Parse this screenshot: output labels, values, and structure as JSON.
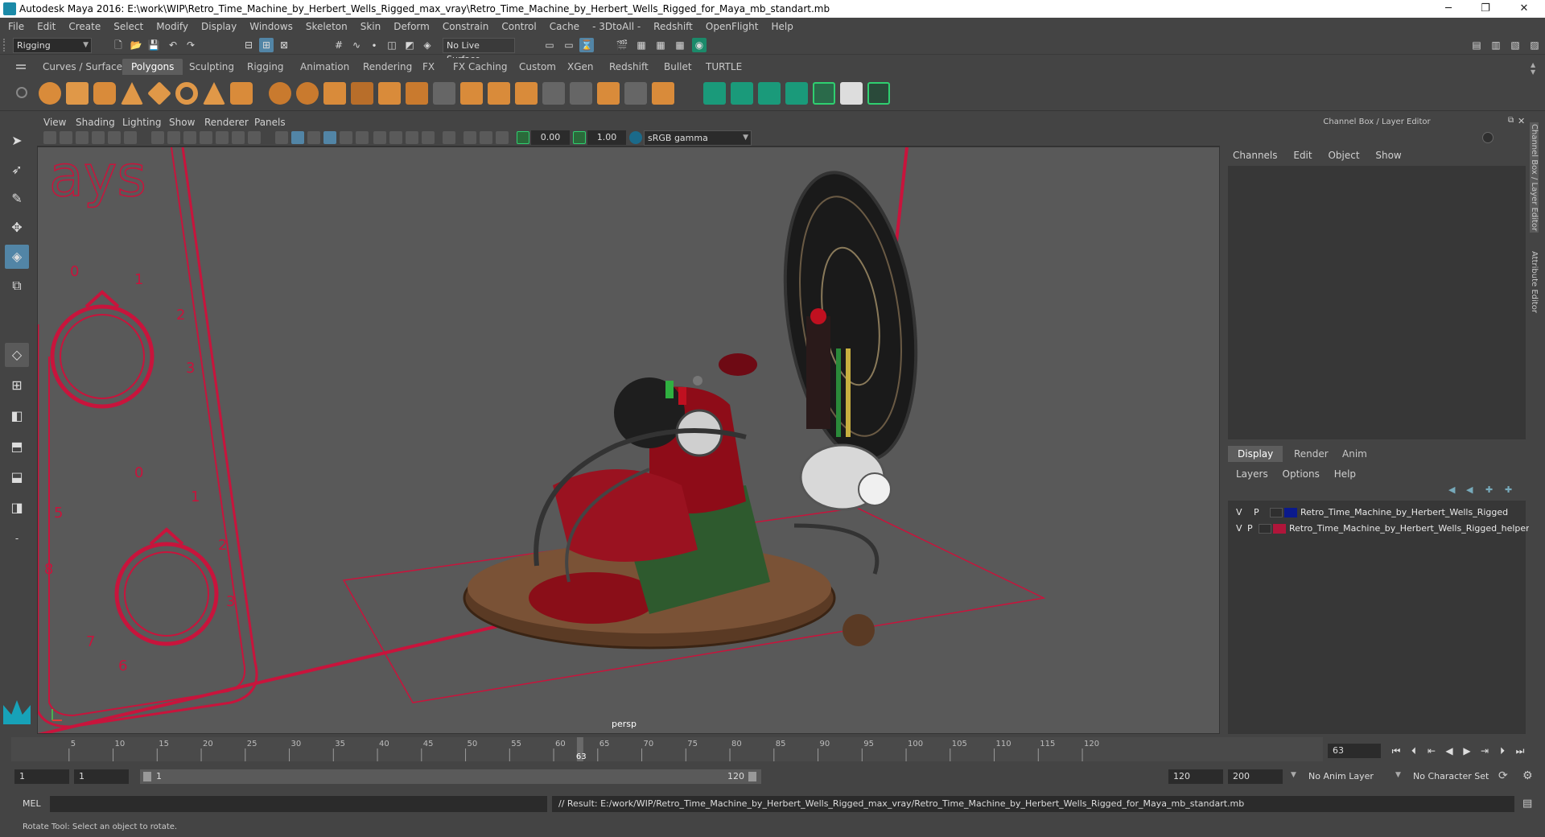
{
  "window": {
    "title": "Autodesk Maya 2016: E:\\work\\WIP\\Retro_Time_Machine_by_Herbert_Wells_Rigged_max_vray\\Retro_Time_Machine_by_Herbert_Wells_Rigged_for_Maya_mb_standart.mb",
    "minimize": "─",
    "maximize": "❐",
    "close": "✕"
  },
  "menubar": [
    "File",
    "Edit",
    "Create",
    "Select",
    "Modify",
    "Display",
    "Windows",
    "Skeleton",
    "Skin",
    "Deform",
    "Constrain",
    "Control",
    "Cache",
    "- 3DtoAll -",
    "Redshift",
    "OpenFlight",
    "Help"
  ],
  "statusline": {
    "mode": "Rigging",
    "live_surface": "No Live Surface"
  },
  "shelf_tabs": [
    "Curves / Surfaces",
    "Polygons",
    "Sculpting",
    "Rigging",
    "Animation",
    "Rendering",
    "FX",
    "FX Caching",
    "Custom",
    "XGen",
    "Redshift",
    "Bullet",
    "TURTLE"
  ],
  "shelf_active_tab": "Polygons",
  "viewport": {
    "menu": [
      "View",
      "Shading",
      "Lighting",
      "Show",
      "Renderer",
      "Panels"
    ],
    "exposure": "0.00",
    "gamma": "1.00",
    "color_space": "sRGB gamma",
    "camera_label": "persp"
  },
  "channel_box": {
    "title": "Channel Box / Layer Editor",
    "menu": [
      "Channels",
      "Edit",
      "Object",
      "Show"
    ]
  },
  "layer_editor": {
    "tabs": [
      "Display",
      "Render",
      "Anim"
    ],
    "active_tab": "Display",
    "menu": [
      "Layers",
      "Options",
      "Help"
    ],
    "layers": [
      {
        "v": "V",
        "p": "P",
        "color": "#0b1a8c",
        "name": "Retro_Time_Machine_by_Herbert_Wells_Rigged"
      },
      {
        "v": "V",
        "p": "P",
        "color": "#b0153a",
        "name": "Retro_Time_Machine_by_Herbert_Wells_Rigged_helpers"
      }
    ]
  },
  "side_tabs": [
    "Channel Box / Layer Editor",
    "Attribute Editor"
  ],
  "timeline": {
    "ticks": [
      "5",
      "10",
      "15",
      "20",
      "25",
      "30",
      "35",
      "40",
      "45",
      "50",
      "55",
      "60",
      "65",
      "70",
      "75",
      "80",
      "85",
      "90",
      "95",
      "100",
      "105",
      "110",
      "115",
      "120"
    ],
    "current_frame": "63",
    "current_frame_field": "63"
  },
  "range": {
    "start": "1",
    "playback_start": "1",
    "slider_start": "1",
    "slider_end": "120",
    "playback_end": "120",
    "end": "200",
    "anim_layer": "No Anim Layer",
    "character_set": "No Character Set"
  },
  "command": {
    "language": "MEL",
    "result": "// Result: E:/work/WIP/Retro_Time_Machine_by_Herbert_Wells_Rigged_max_vray/Retro_Time_Machine_by_Herbert_Wells_Rigged_for_Maya_mb_standart.mb"
  },
  "help_line": "Rotate Tool: Select an object to rotate.",
  "colors": {
    "accent": "#5285a6",
    "curve_red": "#c8143c",
    "viewport_bg": "#595959"
  }
}
